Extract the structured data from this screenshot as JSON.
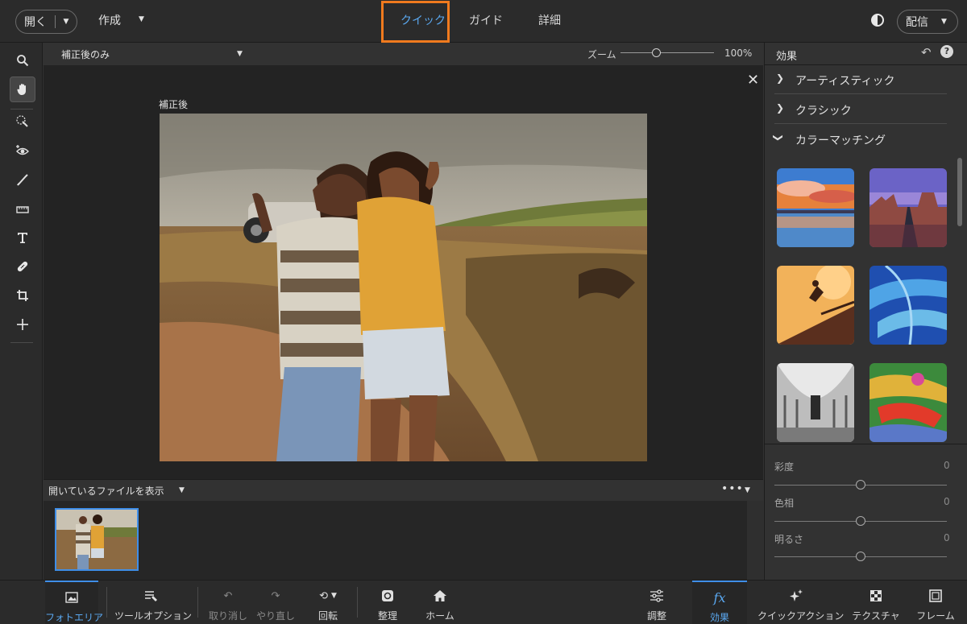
{
  "topbar": {
    "open_label": "開く",
    "create_label": "作成",
    "modes": [
      {
        "label": "クイック",
        "active": true
      },
      {
        "label": "ガイド",
        "active": false
      },
      {
        "label": "詳細",
        "active": false
      }
    ],
    "share_label": "配信"
  },
  "canvas_header": {
    "view_label": "補正後のみ",
    "zoom_label": "ズーム",
    "zoom_value": "100%",
    "zoom_level": 0.38
  },
  "canvas": {
    "after_label": "補正後"
  },
  "file_panel": {
    "title": "開いているファイルを表示",
    "more": "•••"
  },
  "right_panel": {
    "title": "効果",
    "categories": [
      {
        "label": "アーティスティック",
        "expanded": false
      },
      {
        "label": "クラシック",
        "expanded": false
      },
      {
        "label": "カラーマッチング",
        "expanded": true
      }
    ],
    "adjustments": [
      {
        "label": "彩度",
        "value": "0"
      },
      {
        "label": "色相",
        "value": "0"
      },
      {
        "label": "明るさ",
        "value": "0"
      }
    ]
  },
  "bottombar": {
    "items": [
      {
        "label": "フォトエリア",
        "icon": "photo-bin-icon",
        "active": true
      },
      {
        "label": "ツールオプション",
        "icon": "tool-options-icon"
      },
      {
        "label": "取り消し",
        "icon": "undo-icon",
        "dim": true
      },
      {
        "label": "やり直し",
        "icon": "redo-icon",
        "dim": true
      },
      {
        "label": "回転",
        "icon": "rotate-icon"
      },
      {
        "label": "整理",
        "icon": "organizer-icon"
      },
      {
        "label": "ホーム",
        "icon": "home-icon"
      },
      {
        "label": "調整",
        "icon": "adjustments-icon"
      },
      {
        "label": "効果",
        "icon": "effects-icon",
        "active": true
      },
      {
        "label": "クイックアクション",
        "icon": "quick-actions-icon"
      },
      {
        "label": "テクスチャ",
        "icon": "textures-icon"
      },
      {
        "label": "フレーム",
        "icon": "frames-icon"
      }
    ]
  },
  "colors": {
    "accent": "#3f8ee8",
    "highlight": "#f07a1e"
  }
}
